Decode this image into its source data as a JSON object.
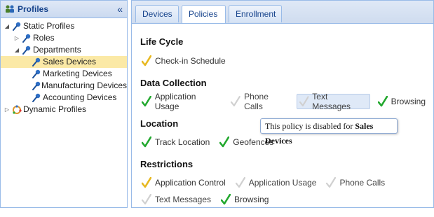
{
  "left_panel": {
    "title": "Profiles",
    "collapse_glyph": "«",
    "tree": {
      "static_profiles": "Static Profiles",
      "roles": "Roles",
      "departments": "Departments",
      "sales": "Sales Devices",
      "marketing": "Marketing Devices",
      "manufacturing": "Manufacturing Devices",
      "accounting": "Accounting Devices",
      "dynamic_profiles": "Dynamic Profiles"
    }
  },
  "tabs": {
    "devices": "Devices",
    "policies": "Policies",
    "enrollment": "Enrollment"
  },
  "sections": {
    "life_cycle": {
      "title": "Life Cycle",
      "items": [
        "Check-in Schedule"
      ]
    },
    "data_collection": {
      "title": "Data Collection",
      "items": [
        "Application Usage",
        "Phone Calls",
        "Text Messages",
        "Browsing"
      ]
    },
    "location": {
      "title": "Location",
      "items": [
        "Track Location",
        "Geofences"
      ]
    },
    "restrictions": {
      "title": "Restrictions",
      "items": [
        "Application Control",
        "Application Usage",
        "Phone Calls",
        "Text Messages",
        "Browsing"
      ]
    }
  },
  "tooltip": {
    "prefix": "This policy is disabled for ",
    "target": "Sales Devices"
  },
  "colors": {
    "check_green": "#22a82e",
    "check_yellow": "#e7b820",
    "check_disabled": "#d0d0d0",
    "selected_row": "#fbe9a6",
    "panel_border": "#99bbe8"
  }
}
